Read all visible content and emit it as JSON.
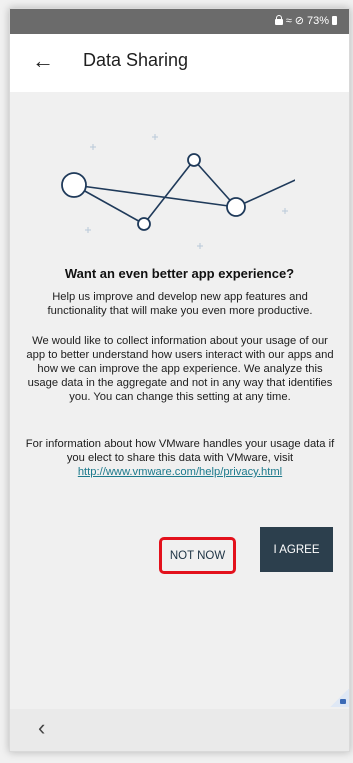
{
  "status_bar": {
    "battery": "73%"
  },
  "header": {
    "title": "Data Sharing"
  },
  "content": {
    "headline": "Want an even better app experience?",
    "paragraph1": "Help us improve and develop new app features and functionality that will make you even more productive.",
    "paragraph2": "We would like to collect information about your usage of our app to better understand how users interact with our apps and how we can improve the app experience. We analyze this usage data in the aggregate and not in any way that identifies you. You can change this setting at any time.",
    "paragraph3_text": "For information about how VMware handles your usage data if you elect to share this data with VMware, visit",
    "privacy_link": "http://www.vmware.com/help/privacy.html"
  },
  "buttons": {
    "not_now": "NOT NOW",
    "agree": "I AGREE"
  },
  "icons": {
    "back": "arrow-left-icon",
    "nav_back": "chevron-left-icon",
    "corner": "lock-icon"
  },
  "colors": {
    "accent_dark": "#2c3f4d",
    "highlight_red": "#e3111c",
    "link": "#1d7a8c",
    "network_line": "#1f3a5a"
  }
}
